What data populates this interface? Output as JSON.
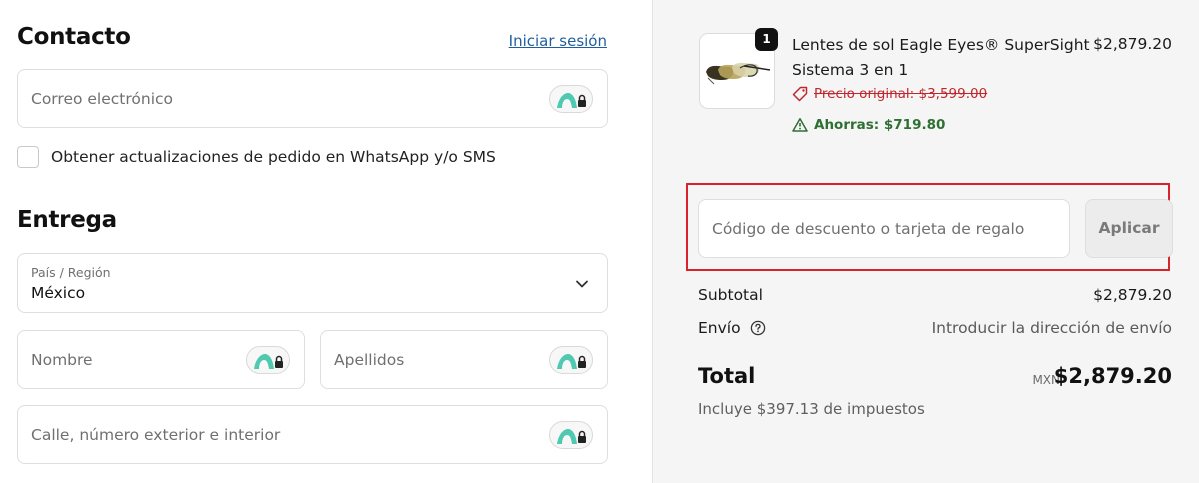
{
  "contact": {
    "title": "Contacto",
    "login_link": "Iniciar sesión",
    "email_placeholder": "Correo electrónico",
    "whatsapp_checkbox_label": "Obtener actualizaciones de pedido en WhatsApp y/o SMS"
  },
  "delivery": {
    "title": "Entrega",
    "country_label": "País / Región",
    "country_value": "México",
    "first_name_placeholder": "Nombre",
    "last_name_placeholder": "Apellidos",
    "street_placeholder": "Calle, número exterior e interior"
  },
  "icons": {
    "password_manager": "password-manager-icon",
    "chevron": "chevron-down-icon",
    "price_tag": "tag-icon",
    "savings": "warning-triangle-icon",
    "help": "help-circle-icon"
  },
  "order": {
    "product": {
      "quantity": "1",
      "name": "Lentes de sol Eagle Eyes® SuperSight Sistema 3 en 1",
      "price": "$2,879.20",
      "original_price": "Precio original: $3,599.00",
      "savings": "Ahorras: $719.80"
    },
    "discount": {
      "placeholder": "Código de descuento o tarjeta de regalo",
      "apply_label": "Aplicar"
    },
    "subtotal_label": "Subtotal",
    "subtotal_value": "$2,879.20",
    "shipping_label": "Envío",
    "shipping_value": "Introducir la dirección de envío",
    "total_label": "Total",
    "total_currency": "MXN",
    "total_value": "$2,879.20",
    "tax_note": "Incluye $397.13 de impuestos"
  },
  "colors": {
    "accent_link": "#1f5f9e",
    "highlight_border": "#d9232b",
    "savings_green": "#2f6f33",
    "original_price_red": "#c0272d",
    "summary_background": "#f5f5f5"
  }
}
